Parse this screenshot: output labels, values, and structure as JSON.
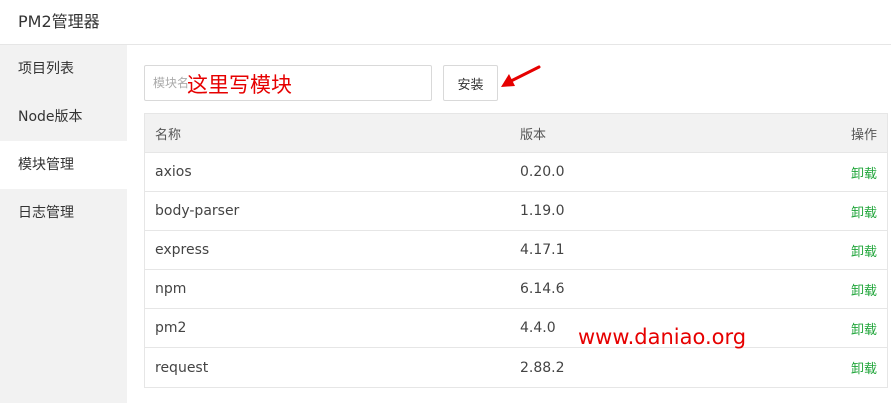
{
  "window": {
    "title": "PM2管理器"
  },
  "sidebar": {
    "items": [
      {
        "label": "项目列表",
        "active": false
      },
      {
        "label": "Node版本",
        "active": false
      },
      {
        "label": "模块管理",
        "active": true
      },
      {
        "label": "日志管理",
        "active": false
      }
    ]
  },
  "toolbar": {
    "search_placeholder": "模块名",
    "search_value": "",
    "install_label": "安装",
    "annotation_text": "这里写模块",
    "arrow_icon": "red-arrow-icon"
  },
  "table": {
    "headers": {
      "name": "名称",
      "version": "版本",
      "action": "操作"
    },
    "rows": [
      {
        "name": "axios",
        "version": "0.20.0",
        "action": "卸载"
      },
      {
        "name": "body-parser",
        "version": "1.19.0",
        "action": "卸载"
      },
      {
        "name": "express",
        "version": "4.17.1",
        "action": "卸载"
      },
      {
        "name": "npm",
        "version": "6.14.6",
        "action": "卸载"
      },
      {
        "name": "pm2",
        "version": "4.4.0",
        "action": "卸载"
      },
      {
        "name": "request",
        "version": "2.88.2",
        "action": "卸载"
      }
    ]
  },
  "watermark": "www.daniao.org",
  "colors": {
    "accent_green": "#20a53a",
    "annotation_red": "#e60000",
    "sidebar_bg": "#f2f2f2"
  }
}
